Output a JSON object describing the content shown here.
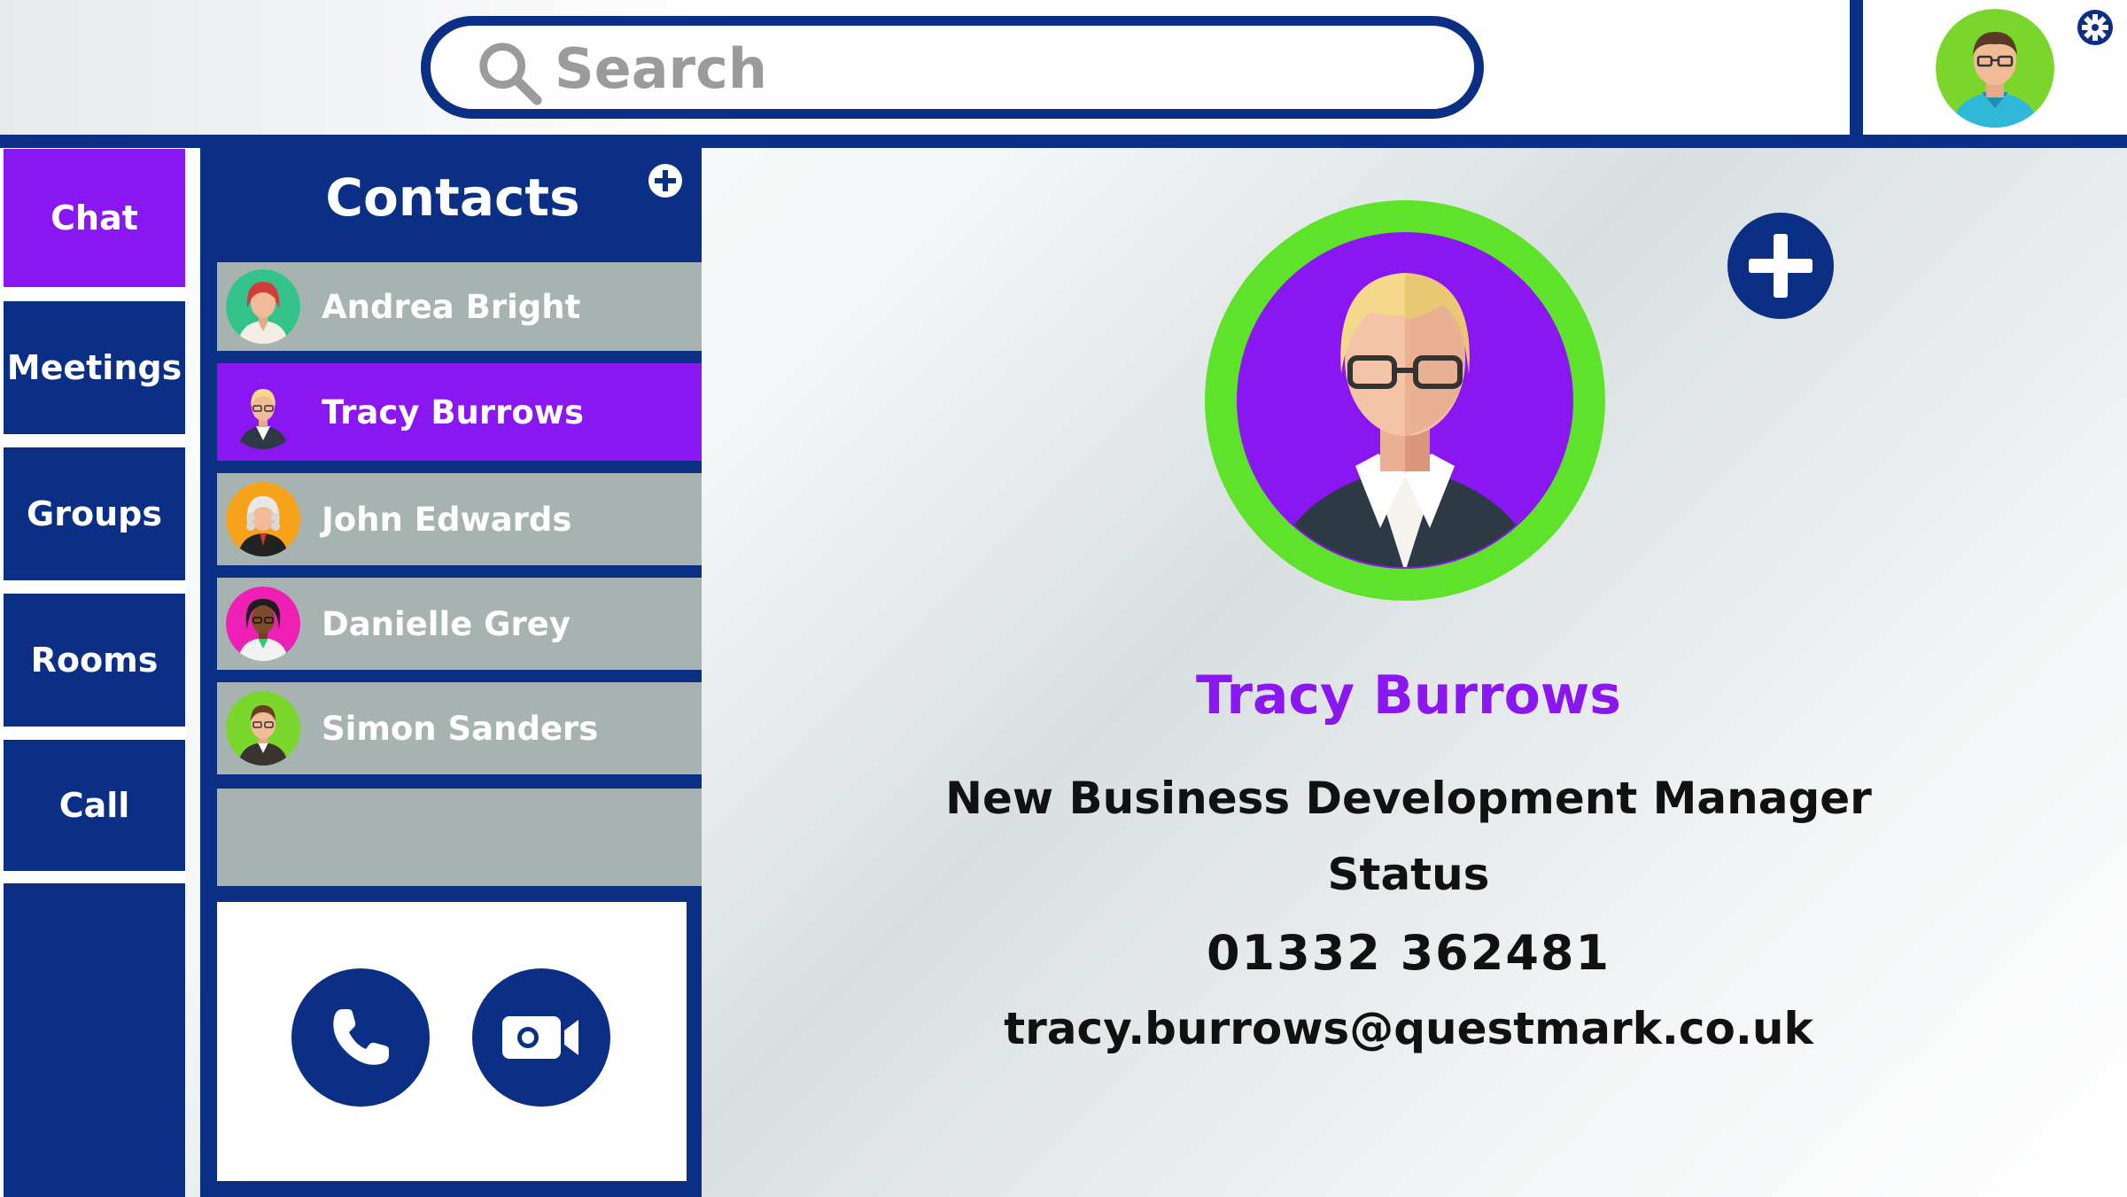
{
  "search": {
    "placeholder": "Search"
  },
  "nav": {
    "items": [
      {
        "label": "Chat",
        "active": true
      },
      {
        "label": "Meetings"
      },
      {
        "label": "Groups"
      },
      {
        "label": "Rooms"
      },
      {
        "label": "Call"
      }
    ]
  },
  "contacts": {
    "title": "Contacts",
    "list": [
      {
        "name": "Andrea Bright",
        "avatar_color": "#34c48b"
      },
      {
        "name": "Tracy Burrows",
        "avatar_color": "#8a16f2",
        "selected": true
      },
      {
        "name": "John Edwards",
        "avatar_color": "#f7a21b"
      },
      {
        "name": "Danielle Grey",
        "avatar_color": "#ee1fb4"
      },
      {
        "name": "Simon Sanders",
        "avatar_color": "#7ad62b"
      }
    ]
  },
  "profile": {
    "name": "Tracy Burrows",
    "title": "New Business Development Manager",
    "status": "Status",
    "phone": "01332 362481",
    "email": "tracy.burrows@questmark.co.uk"
  },
  "colors": {
    "navy": "#0c2f86",
    "purple": "#8a16f2",
    "green": "#5ee32a",
    "row_gray": "#a6b3b1"
  }
}
